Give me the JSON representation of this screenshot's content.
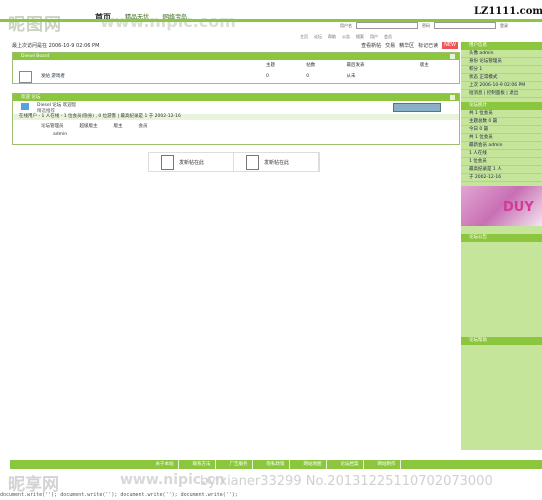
{
  "watermarks": {
    "site_cn": "昵图网",
    "site_url": "www.nipic.com",
    "bottom_cn": "昵享网",
    "bottom_url": "www.nipic.cn",
    "bottom_id": "by:xianer33299 No.20131225110702073000"
  },
  "header": {
    "nav": [
      "首页",
      "精品无忧",
      "网络宝岛"
    ],
    "logo": "LZ1111.com",
    "login_labels": [
      "用户名",
      "密码",
      "登录"
    ],
    "links": [
      "主页",
      "论坛",
      "帮助",
      "公告",
      "搜索",
      "用户",
      "会员"
    ]
  },
  "online": {
    "title": "最上次访问是在 2006-10-9 02:06 PM",
    "actions": [
      "查看新帖",
      "交易",
      "精华区",
      "标记已读"
    ],
    "new_badge": "NEW"
  },
  "board": {
    "category": "Diesel Board",
    "columns": [
      "论坛",
      "主题",
      "帖数",
      "最后发表",
      "版主"
    ],
    "rows": [
      {
        "name": "发帖 游戏者",
        "topics": "0",
        "posts": "0",
        "last": "从未"
      }
    ]
  },
  "stats": {
    "title": "欢迎 论坛",
    "subtitle": "Diesel 论坛 欢迎您",
    "desc": "精选推荐",
    "online_title": "在线用户 - 1 人在线 - 1 位会员(隐身) , 0 位游客 | 最高纪录是 1 于 2002-12-16",
    "legend": [
      "论坛管理员",
      "超级版主",
      "版主",
      "会员"
    ],
    "admin_name": "admin"
  },
  "actions": {
    "new_topic": "发新帖在此",
    "new_reply": "发新帖在此"
  },
  "sidebar": {
    "title1": "用户信息",
    "rows1": [
      "头像 admin",
      "身份 论坛管理员",
      "积分 1",
      "状态 正常模式",
      "上次 2006-10-9 02:06 PM"
    ],
    "links": "短消息 | 控制面板 | 退出",
    "title2": "论坛统计",
    "rows2": [
      "共 1 位会员",
      "主题总数 0 篇",
      "今日 0 篇",
      "共 1 位会员",
      "最新会员 admin",
      "1 人在线",
      "1 位会员",
      "最高纪录是 1 人",
      "于 2002-12-16"
    ],
    "ad_text": "DUY",
    "title3": "论坛公告",
    "title4": "论坛帮助"
  },
  "footer": {
    "links": [
      "关于本站",
      "联系方法",
      "广告服务",
      "隐私政策",
      "网站地图",
      "论坛档案",
      "网站制作"
    ]
  },
  "docwrite": "document.write(''); document.write(''); document.write(''); document.write('');"
}
